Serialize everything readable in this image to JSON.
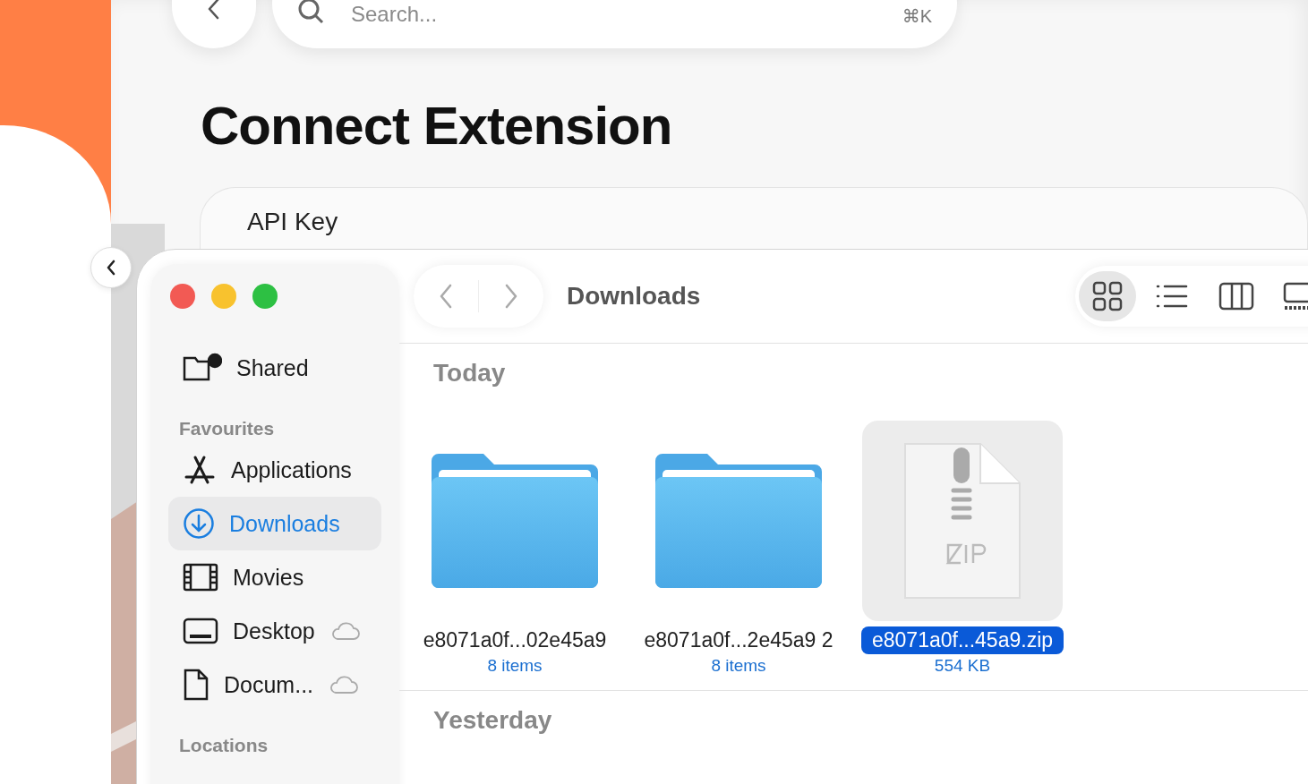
{
  "page": {
    "search": {
      "placeholder": "Search...",
      "shortcut": "⌘K"
    },
    "title": "Connect Extension",
    "card": {
      "label": "API Key"
    }
  },
  "finder": {
    "title": "Downloads",
    "views": [
      {
        "kind": "grid",
        "selected": true
      },
      {
        "kind": "list",
        "selected": false
      },
      {
        "kind": "columns",
        "selected": false
      },
      {
        "kind": "gallery",
        "selected": false
      }
    ],
    "sidebar": [
      {
        "items": [
          {
            "kind": "shared",
            "label": "Shared",
            "selected": false,
            "cloud": false
          }
        ]
      },
      {
        "title": "Favourites",
        "items": [
          {
            "kind": "applications",
            "label": "Applications",
            "selected": false,
            "cloud": false
          },
          {
            "kind": "downloads",
            "label": "Downloads",
            "selected": true,
            "cloud": false
          },
          {
            "kind": "movies",
            "label": "Movies",
            "selected": false,
            "cloud": false
          },
          {
            "kind": "desktop",
            "label": "Desktop",
            "selected": false,
            "cloud": true
          },
          {
            "kind": "document",
            "label": "Docum...",
            "selected": false,
            "cloud": true
          }
        ]
      },
      {
        "title": "Locations"
      }
    ],
    "groups": [
      {
        "title": "Today",
        "files": [
          {
            "kind": "folder",
            "name": "e8071a0f...02e45a9",
            "detail": "8 items",
            "selected": false
          },
          {
            "kind": "folder",
            "name": "e8071a0f...2e45a9 2",
            "detail": "8 items",
            "selected": false
          },
          {
            "kind": "zip",
            "name": "e8071a0f...45a9.zip",
            "detail": "554 KB",
            "selected": true
          }
        ]
      },
      {
        "title": "Yesterday"
      }
    ]
  }
}
